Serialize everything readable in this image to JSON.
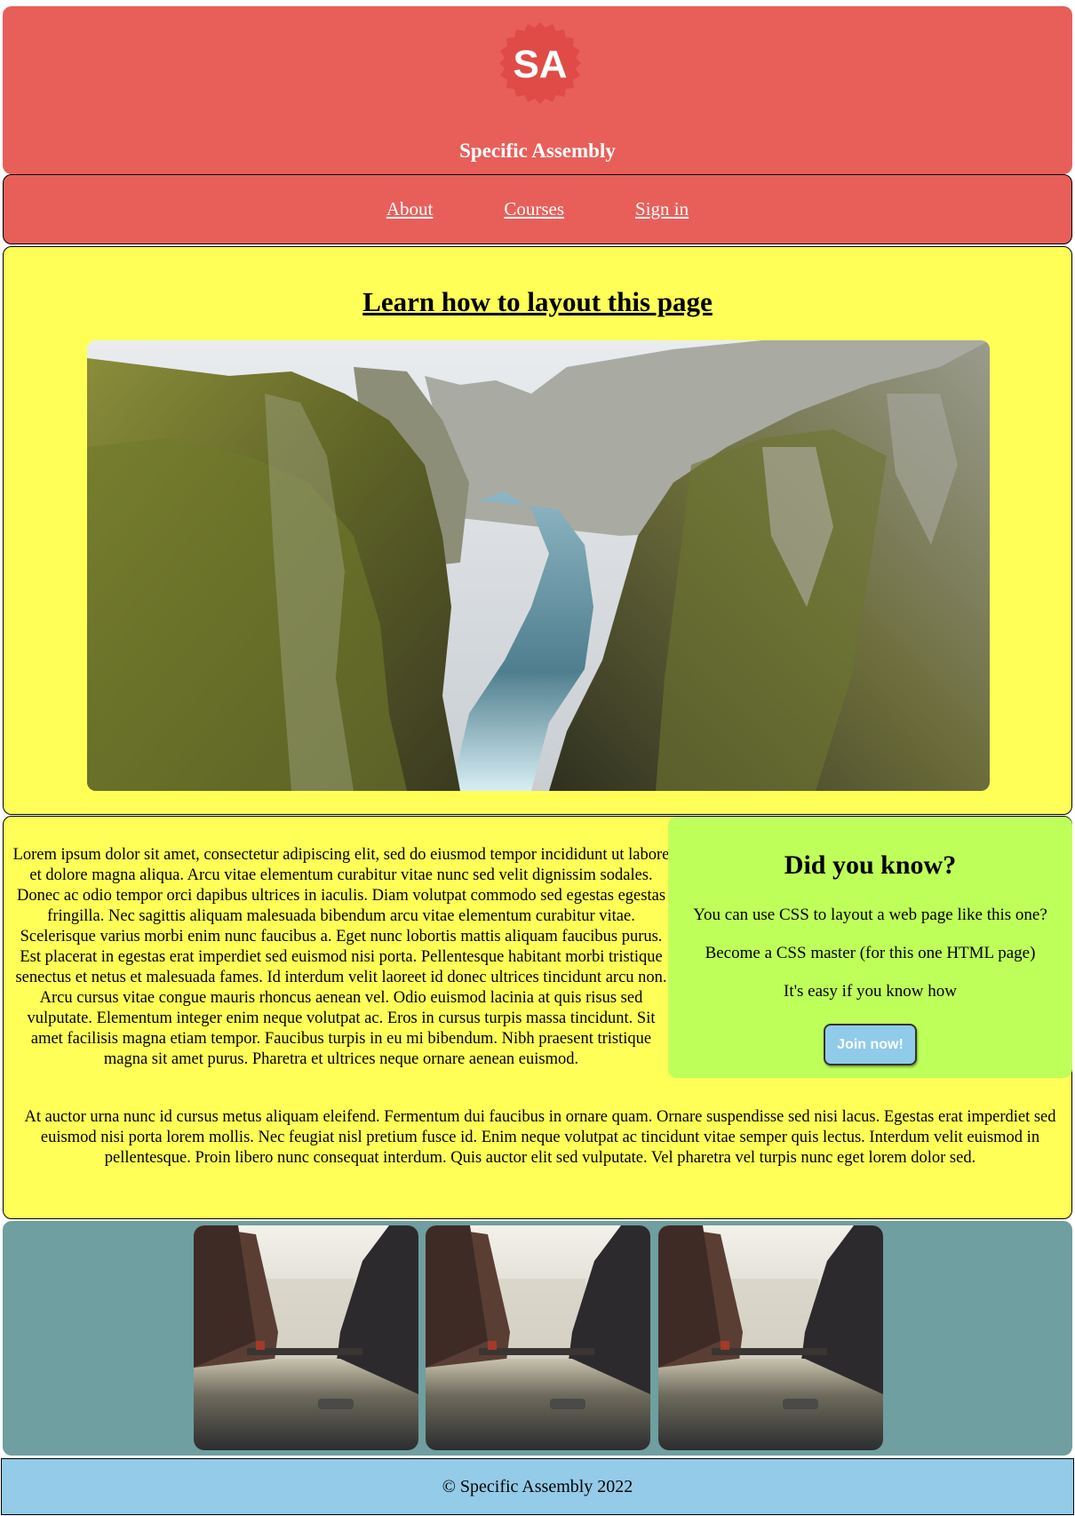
{
  "header": {
    "logo_text": "SA",
    "site_title": "Specific Assembly"
  },
  "nav": {
    "items": [
      {
        "label": "About"
      },
      {
        "label": "Courses"
      },
      {
        "label": "Sign in"
      }
    ]
  },
  "hero": {
    "title": "Learn how to layout this page",
    "image": "canyon-river-photo"
  },
  "content": {
    "paragraph1": "Lorem ipsum dolor sit amet, consectetur adipiscing elit, sed do eiusmod tempor incididunt ut labore et dolore magna aliqua. Arcu vitae elementum curabitur vitae nunc sed velit dignissim sodales. Donec ac odio tempor orci dapibus ultrices in iaculis. Diam volutpat commodo sed egestas egestas fringilla. Nec sagittis aliquam malesuada bibendum arcu vitae elementum curabitur vitae. Scelerisque varius morbi enim nunc faucibus a. Eget nunc lobortis mattis aliquam faucibus purus. Est placerat in egestas erat imperdiet sed euismod nisi porta. Pellentesque habitant morbi tristique senectus et netus et malesuada fames. Id interdum velit laoreet id donec ultrices tincidunt arcu non. Arcu cursus vitae congue mauris rhoncus aenean vel. Odio euismod lacinia at quis risus sed vulputate. Elementum integer enim neque volutpat ac. Eros in cursus turpis massa tincidunt. Sit amet facilisis magna etiam tempor. Faucibus turpis in eu mi bibendum. Nibh praesent tristique magna sit amet purus. Pharetra et ultrices neque ornare aenean euismod.",
    "paragraph2": "At auctor urna nunc id cursus metus aliquam eleifend. Fermentum dui faucibus in ornare quam. Ornare suspendisse sed nisi lacus. Egestas erat imperdiet sed euismod nisi porta lorem mollis. Nec feugiat nisl pretium fusce id. Enim neque volutpat ac tincidunt vitae semper quis lectus. Interdum velit euismod in pellentesque. Proin libero nunc consequat interdum. Quis auctor elit sed vulputate. Vel pharetra vel turpis nunc eget lorem dolor sed."
  },
  "sidebar": {
    "title": "Did you know?",
    "lines": [
      "You can use CSS to layout a web page like this one?",
      "Become a CSS master (for this one HTML page)",
      "It's easy if you know how"
    ],
    "button_label": "Join now!"
  },
  "gallery": {
    "images": [
      "canal-city-photo",
      "canal-city-photo",
      "canal-city-photo"
    ]
  },
  "footer": {
    "text": "© Specific Assembly 2022"
  },
  "colors": {
    "header_bg": "#e85f5a",
    "content_bg": "#ffff57",
    "sidebar_bg": "#beff5a",
    "gallery_bg": "#6f9fa0",
    "footer_bg": "#93cbe8",
    "button_bg": "#90cbe9"
  }
}
